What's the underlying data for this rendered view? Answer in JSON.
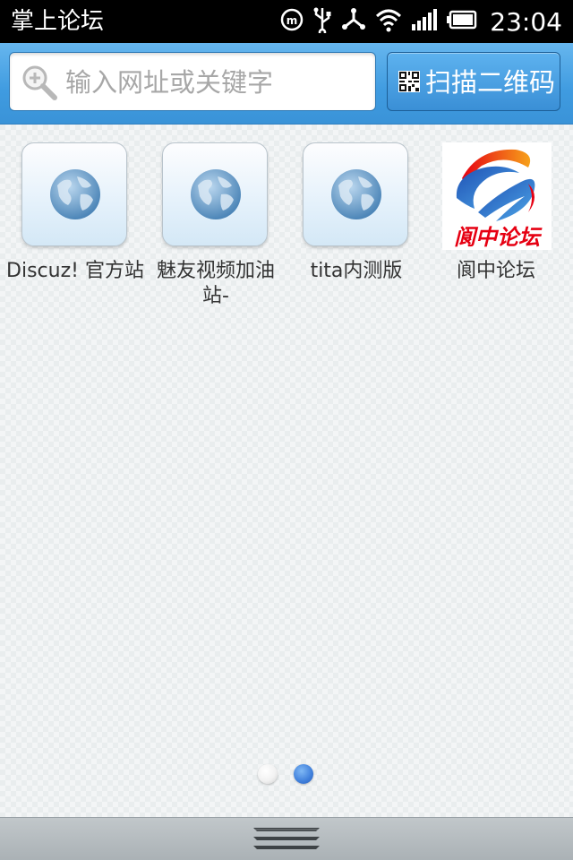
{
  "status_bar": {
    "app_title": "掌上论坛",
    "time": "23:04",
    "icons": [
      "m-icon",
      "usb-icon",
      "share-icon",
      "wifi-icon",
      "signal-icon",
      "battery-icon"
    ]
  },
  "search": {
    "placeholder": "输入网址或关键字",
    "scan_label": "扫描二维码"
  },
  "shortcuts": [
    {
      "label": "Discuz! 官方站",
      "icon": "globe-icon"
    },
    {
      "label": "魅友视频加油站-",
      "icon": "globe-icon"
    },
    {
      "label": "tita内测版",
      "icon": "globe-icon"
    },
    {
      "label": "阆中论坛",
      "icon": "forum-logo",
      "logo_text": "阆中论坛"
    }
  ],
  "pager": {
    "page_count": 2,
    "current_page": 2
  },
  "colors": {
    "accent_blue": "#3a93d8",
    "logo_red": "#e60012",
    "logo_blue": "#1e50b4"
  }
}
